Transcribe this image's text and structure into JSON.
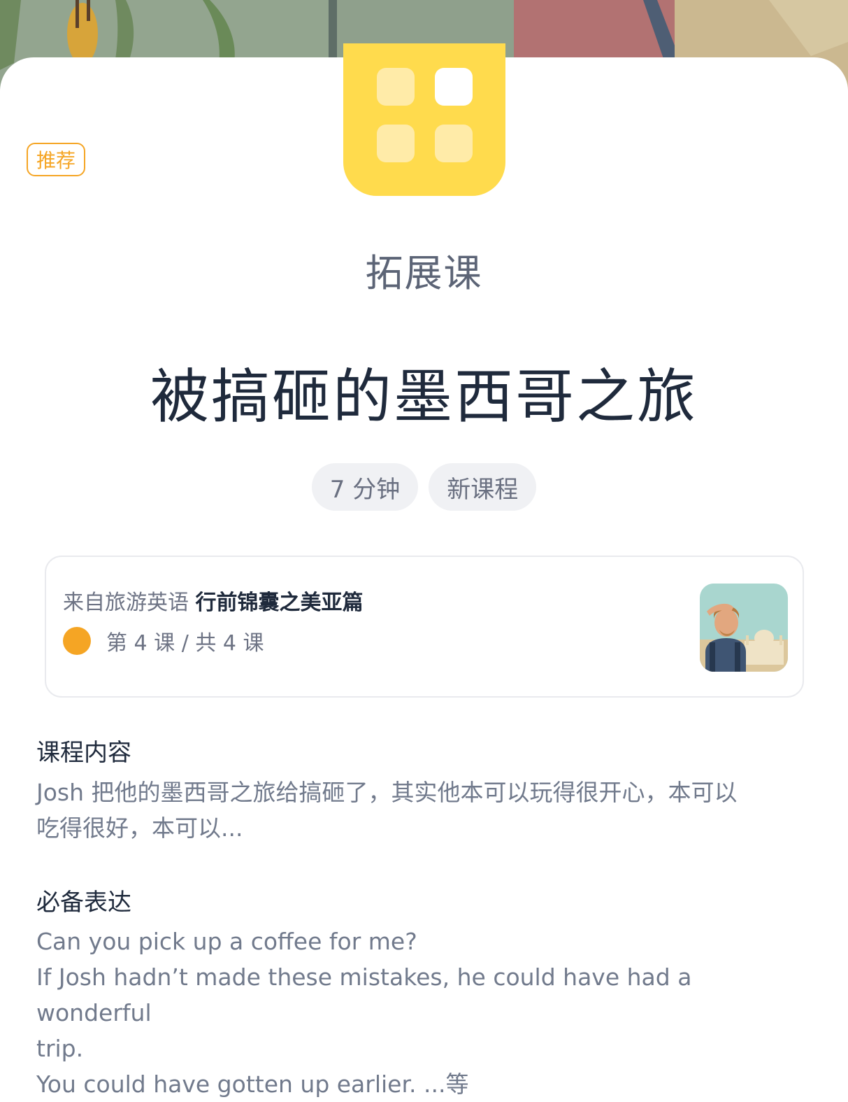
{
  "badge": {
    "label": "推荐"
  },
  "header": {
    "category": "拓展课",
    "title": "被搞砸的墨西哥之旅"
  },
  "chips": [
    {
      "label": "7 分钟"
    },
    {
      "label": "新课程"
    }
  ],
  "course": {
    "from_prefix": "来自旅游英语",
    "course_name": "行前锦囊之美亚篇",
    "progress": "第 4 课 / 共 4 课",
    "status_color": "#f5a524"
  },
  "content_section": {
    "heading": "课程内容",
    "lines": [
      "Josh 把他的墨西哥之旅给搞砸了，其实他本可以玩得很开心，本可以",
      "吃得很好，本可以..."
    ]
  },
  "expressions_section": {
    "heading": "必备表达",
    "lines": [
      "Can you pick up a coffee for me?",
      "If Josh hadn’t made these mistakes, he could have had a wonderful",
      "trip.",
      "You could have gotten up earlier. ...等"
    ]
  },
  "colors": {
    "accent": "#f5a524",
    "icon_yellow": "#ffdb4d",
    "title": "#1f2a3c",
    "muted": "#717a8c"
  },
  "icons": {
    "app": "grid-app-icon",
    "thumb": "traveler-thumbnail"
  }
}
